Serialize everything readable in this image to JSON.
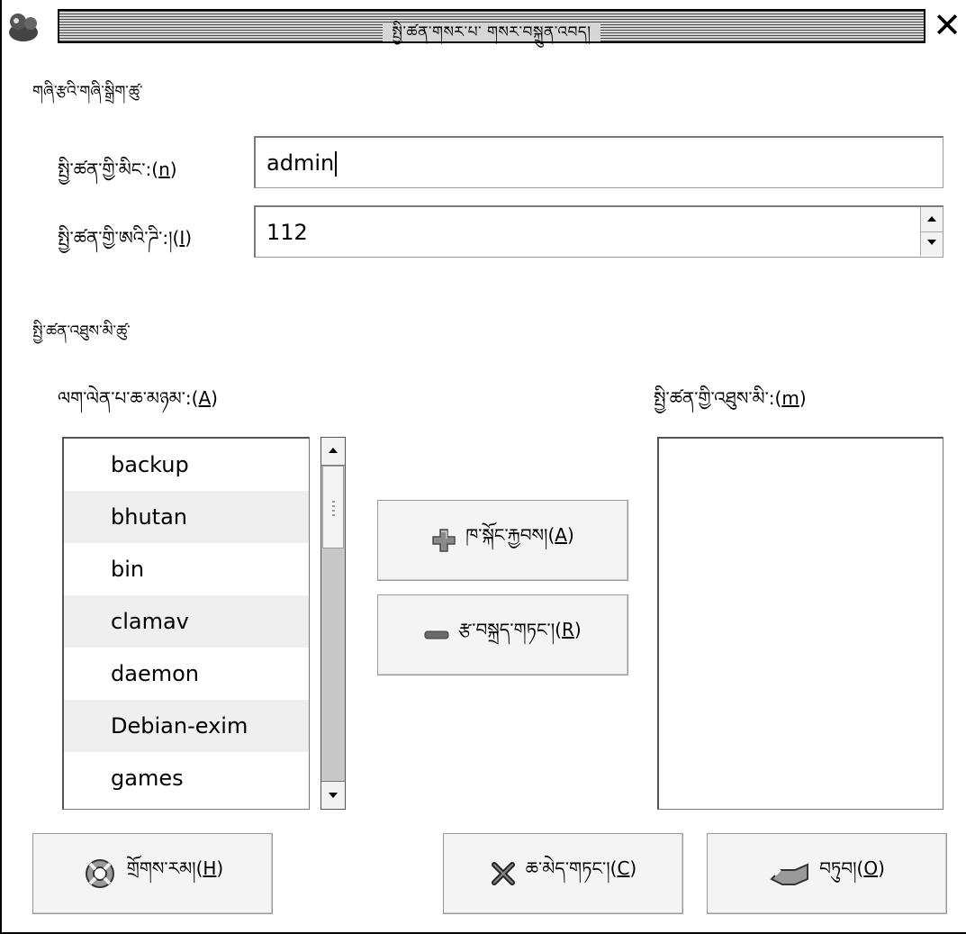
{
  "window": {
    "title": "སྤྱི་ཚན་གསར་པ་ གསར་བསྐྲུན་འབད།",
    "close_glyph": "✕"
  },
  "basic_settings": {
    "section_title": "གཞི་རྩའི་གཞི་སྒྲིག་ཚུ་",
    "name_label_prefix": "སྤྱི་ཚན་གྱི་མིང་:(",
    "name_label_mnemonic": "n",
    "name_label_suffix": ")",
    "name_value": "admin",
    "id_label_prefix": "སྤྱི་ཚན་གྱི་ཨའི་ཌི་:།(",
    "id_label_mnemonic": "I",
    "id_label_suffix": ")",
    "id_value": "112"
  },
  "members": {
    "section_title": "སྤྱི་ཚན་འཐུས་མི་ཚུ་",
    "all_users_label_prefix": "ལག་ལེན་པ་ཆ་མཉམ་:(",
    "all_users_label_mnemonic": "A",
    "all_users_label_suffix": ")",
    "group_members_label_prefix": "སྤྱི་ཚན་གྱི་འཐུས་མི་:(",
    "group_members_label_mnemonic": "m",
    "group_members_label_suffix": ")",
    "users": [
      "backup",
      "bhutan",
      "bin",
      "clamav",
      "daemon",
      "Debian-exim",
      "games"
    ],
    "group_members": []
  },
  "buttons": {
    "add_prefix": "ཁ་སྐོང་རྐྱབས།(",
    "add_mnemonic": "A",
    "add_suffix": ")",
    "remove_prefix": "རྩ་བསྐྲད་གཏང་།(",
    "remove_mnemonic": "R",
    "remove_suffix": ")",
    "help_prefix": "གྲོགས་རམ།(",
    "help_mnemonic": "H",
    "help_suffix": ")",
    "cancel_prefix": "ཆ་མེད་གཏང་།(",
    "cancel_mnemonic": "C",
    "cancel_suffix": ")",
    "ok_prefix": "བཏུབ།(",
    "ok_mnemonic": "O",
    "ok_suffix": ")"
  },
  "colors": {
    "add_icon": "#8a8a8a",
    "remove_icon": "#6a6a6a"
  }
}
